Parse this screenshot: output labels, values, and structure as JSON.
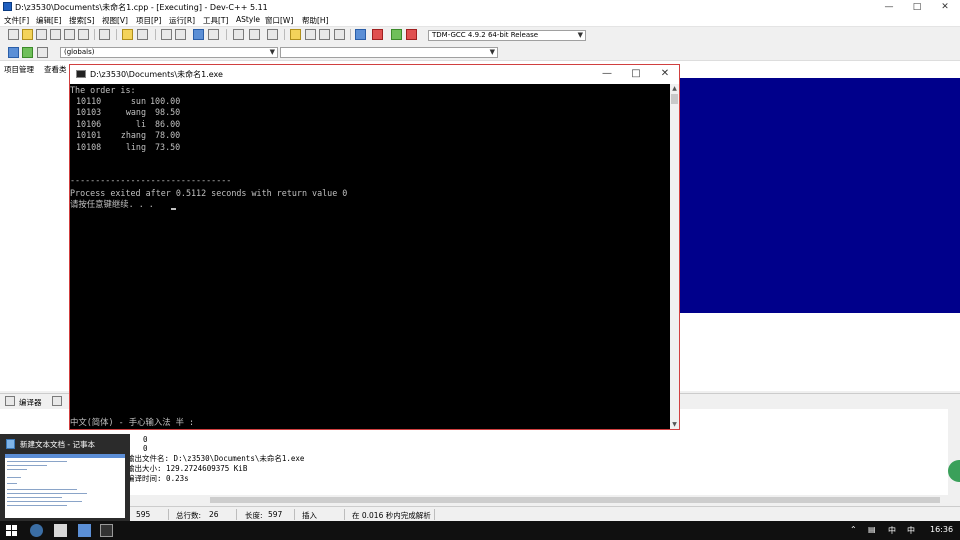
{
  "ide": {
    "title": "D:\\z3530\\Documents\\未命名1.cpp - [Executing] - Dev-C++ 5.11",
    "menu": [
      "文件[F]",
      "编辑[E]",
      "搜索[S]",
      "视图[V]",
      "项目[P]",
      "运行[R]",
      "工具[T]",
      "AStyle",
      "窗口[W]",
      "帮助[H]"
    ],
    "compiler_select": "TDM-GCC 4.9.2 64-bit Release",
    "scope_select": "(globals)",
    "left_tabs": [
      "项目管理",
      "查看类"
    ],
    "bottom_tabs": [
      "编译器"
    ],
    "output_lines": [
      "- 输出文件名: D:\\z3530\\Documents\\未命名1.exe",
      "- 输出大小: 129.2724609375 KiB",
      "- 编译时间: 0.23s"
    ],
    "output_partial": [
      "0",
      "0"
    ],
    "status": {
      "col_value": "595",
      "total_lines_label": "总行数:",
      "total_lines_value": "26",
      "length_label": "长度:",
      "length_value": "597",
      "mode": "插入",
      "message": "在 0.016 秒内完成解析"
    }
  },
  "console": {
    "title": "D:\\z3530\\Documents\\未命名1.exe",
    "header": "The order is:",
    "rows": [
      {
        "id": "10110",
        "name": "sun",
        "score": "100.00"
      },
      {
        "id": "10103",
        "name": "wang",
        "score": "98.50"
      },
      {
        "id": "10106",
        "name": "li",
        "score": "86.00"
      },
      {
        "id": "10101",
        "name": "zhang",
        "score": "78.00"
      },
      {
        "id": "10108",
        "name": "ling",
        "score": "73.50"
      }
    ],
    "separator": "--------------------------------",
    "exit_message": "Process exited after 0.5112 seconds with return value 0",
    "prompt": "请按任意键继续. . .",
    "ime_line": "中文(简体) - 手心输入法 半 :"
  },
  "notepad_thumbnail": {
    "title": "新建文本文档 - 记事本"
  },
  "taskbar": {
    "tray_lang": "中",
    "tray_ime": "中",
    "clock": "16:36"
  }
}
